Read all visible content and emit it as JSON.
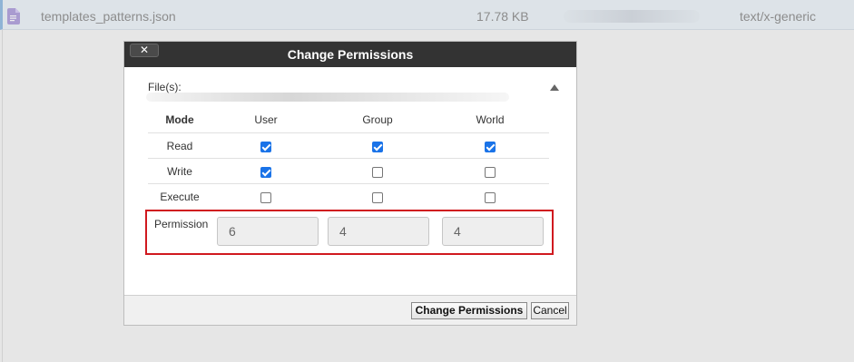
{
  "file_row": {
    "name": "templates_patterns.json",
    "size": "17.78 KB",
    "type": "text/x-generic",
    "icon": "document-icon"
  },
  "dialog": {
    "title": "Change Permissions",
    "close_label": "✕",
    "files_label": "File(s):",
    "table": {
      "headers": [
        "Mode",
        "User",
        "Group",
        "World"
      ],
      "rows": [
        {
          "label": "Read",
          "user": true,
          "group": true,
          "world": true
        },
        {
          "label": "Write",
          "user": true,
          "group": false,
          "world": false
        },
        {
          "label": "Execute",
          "user": false,
          "group": false,
          "world": false
        }
      ]
    },
    "permission": {
      "label": "Permission",
      "user": "6",
      "group": "4",
      "world": "4"
    },
    "buttons": {
      "change_label": "Change Permissions",
      "cancel_label": "Cancel"
    }
  },
  "colors": {
    "highlight_border": "#d0191f",
    "checkbox_checked": "#1a73e8",
    "titlebar": "#333333"
  }
}
